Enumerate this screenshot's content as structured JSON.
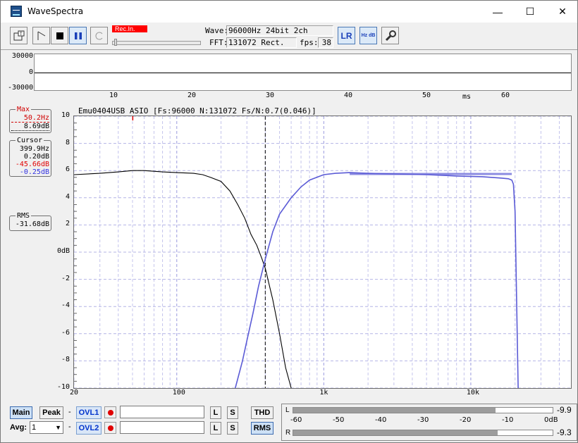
{
  "window": {
    "title": "WaveSpectra",
    "min_label": "—",
    "max_label": "☐",
    "close_label": "✕"
  },
  "toolbar": {
    "rec_indicator": "Rec.In.",
    "wave_label": "Wave:",
    "wave_value": "96000Hz 24bit 2ch",
    "fft_label": "FFT:",
    "fft_value": "131072 Rect.",
    "fps_label": "fps:",
    "fps_value": "38",
    "lr_label": "LR",
    "hz_db_label": "Hz dB"
  },
  "scope": {
    "y_labels": [
      "30000",
      "0",
      "-30000"
    ],
    "x_labels": [
      "10",
      "20",
      "30",
      "40",
      "50",
      "60"
    ],
    "x_unit": "ms"
  },
  "spectrum": {
    "title": "Emu0404USB ASIO  [Fs:96000 N:131072 Fs/N:0.7(0.046)]",
    "max_box": {
      "caption": "Max",
      "freq": "50.2Hz",
      "level": "8.69dB"
    },
    "cursor_box": {
      "caption": "Cursor",
      "freq": "399.9Hz",
      "v1": "0.20dB",
      "v2": "-45.66dB",
      "v3": "-0.25dB"
    },
    "rms_box": {
      "caption": "RMS",
      "value": "-31.68dB"
    },
    "y_labels": [
      "10",
      "8",
      "6",
      "4",
      "2",
      "0dB",
      "-2",
      "-4",
      "-6",
      "-8",
      "-10"
    ],
    "x_labels": [
      "20",
      "100",
      "1k",
      "10k"
    ]
  },
  "colors": {
    "ch1": "#000000",
    "ch2": "#5b5bd6",
    "rec": "#ff0000",
    "cursor_red": "#e00000",
    "cursor_blue": "#3030e0"
  },
  "chart_data": {
    "type": "line",
    "x_scale": "log",
    "xlim": [
      20,
      48000
    ],
    "ylim": [
      -10,
      10
    ],
    "x_unit": "Hz",
    "y_unit": "dB",
    "grid": true,
    "cursor_freq": 399.9,
    "series": [
      {
        "x": [
          20,
          30,
          40,
          50,
          60,
          80,
          100,
          130,
          150,
          170,
          200,
          230,
          260,
          290,
          320,
          350,
          380,
          400,
          450,
          500,
          550,
          600
        ],
        "y": [
          5.7,
          5.8,
          5.9,
          6.0,
          6.0,
          5.9,
          5.85,
          5.8,
          5.7,
          5.5,
          5.2,
          4.5,
          3.5,
          2.5,
          1.3,
          0.5,
          -0.5,
          -1.2,
          -3.5,
          -6.0,
          -8.5,
          -10.0
        ]
      },
      {
        "x": [
          250,
          280,
          300,
          330,
          360,
          400,
          450,
          500,
          600,
          700,
          800,
          1000,
          1200,
          1500,
          2000,
          3000,
          5000,
          8000,
          12000,
          16000,
          18000,
          19000,
          19500,
          20000,
          21000
        ],
        "y": [
          -10,
          -8,
          -6.5,
          -4.5,
          -2.5,
          -0.5,
          1.5,
          2.8,
          4.0,
          4.8,
          5.3,
          5.7,
          5.8,
          5.85,
          5.8,
          5.75,
          5.7,
          5.6,
          5.55,
          5.45,
          5.4,
          5.3,
          5.0,
          3.0,
          -10.0
        ]
      }
    ]
  },
  "bottom": {
    "main_label": "Main",
    "peak_label": "Peak",
    "avg_label": "Avg:",
    "avg_value": "1",
    "ovl1_label": "OVL1",
    "ovl2_label": "OVL2",
    "l_label": "L",
    "s_label": "S",
    "thd_label": "THD",
    "rms_label": "RMS",
    "meter": {
      "ch_l": "L",
      "ch_r": "R",
      "scale": [
        "-60",
        "-50",
        "-40",
        "-30",
        "-20",
        "-10",
        "0dB"
      ],
      "l_value": "-9.9",
      "r_value": "-9.3",
      "l_level_db": -9.9,
      "r_level_db": -9.3
    }
  }
}
